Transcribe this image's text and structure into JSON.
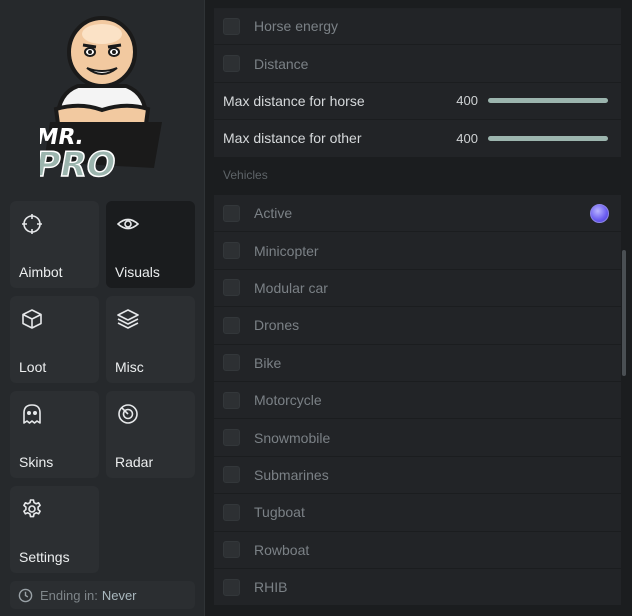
{
  "sidebar": {
    "tiles": [
      {
        "label": "Aimbot",
        "icon": "crosshair-icon"
      },
      {
        "label": "Visuals",
        "icon": "eye-icon"
      },
      {
        "label": "Loot",
        "icon": "box-icon"
      },
      {
        "label": "Misc",
        "icon": "layers-icon"
      },
      {
        "label": "Skins",
        "icon": "ghost-icon"
      },
      {
        "label": "Radar",
        "icon": "radar-icon"
      },
      {
        "label": "Settings",
        "icon": "gear-icon"
      }
    ],
    "active_tile": "Visuals",
    "ending_label": "Ending in:",
    "ending_value": "Never"
  },
  "main": {
    "top_rows": [
      {
        "label": "Horse energy"
      },
      {
        "label": "Distance"
      }
    ],
    "sliders": [
      {
        "label": "Max distance for horse",
        "value": "400"
      },
      {
        "label": "Max distance for other",
        "value": "400"
      }
    ],
    "vehicles_title": "Vehicles",
    "vehicle_rows": [
      {
        "label": "Active"
      },
      {
        "label": "Minicopter"
      },
      {
        "label": "Modular car"
      },
      {
        "label": "Drones"
      },
      {
        "label": "Bike"
      },
      {
        "label": "Motorcycle"
      },
      {
        "label": "Snowmobile"
      },
      {
        "label": "Submarines"
      },
      {
        "label": "Tugboat"
      },
      {
        "label": "Rowboat"
      },
      {
        "label": "RHIB"
      }
    ]
  },
  "colors": {
    "accent": "#9cb5ae",
    "active_color_swatch": "#6a5cf0",
    "sidebar_bg": "#26292c",
    "main_bg": "#1b1d1f"
  }
}
